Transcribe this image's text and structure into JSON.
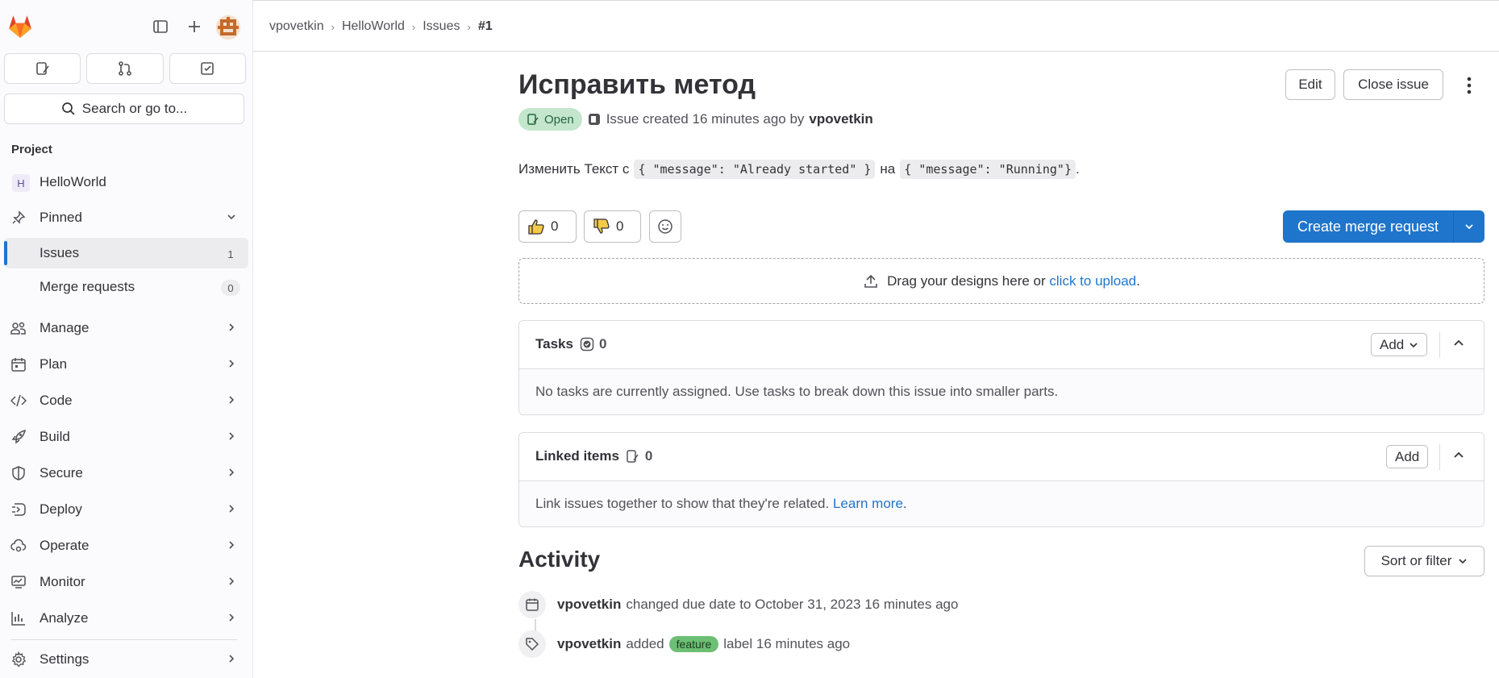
{
  "sidebar": {
    "search_label": "Search or go to...",
    "section_title": "Project",
    "project": {
      "initial": "H",
      "name": "HelloWorld"
    },
    "pinned_label": "Pinned",
    "pinned_items": [
      {
        "label": "Issues",
        "count": "1"
      },
      {
        "label": "Merge requests",
        "count": "0"
      }
    ],
    "menu": [
      {
        "label": "Manage",
        "icon": "users-icon"
      },
      {
        "label": "Plan",
        "icon": "calendar-icon"
      },
      {
        "label": "Code",
        "icon": "code-icon"
      },
      {
        "label": "Build",
        "icon": "rocket-icon"
      },
      {
        "label": "Secure",
        "icon": "shield-icon"
      },
      {
        "label": "Deploy",
        "icon": "deploy-icon"
      },
      {
        "label": "Operate",
        "icon": "cloud-gear-icon"
      },
      {
        "label": "Monitor",
        "icon": "monitor-icon"
      },
      {
        "label": "Analyze",
        "icon": "chart-icon"
      }
    ],
    "settings_label": "Settings"
  },
  "breadcrumbs": [
    "vpovetkin",
    "HelloWorld",
    "Issues",
    "#1"
  ],
  "issue": {
    "title": "Исправить метод",
    "status": "Open",
    "meta_prefix": "Issue created 16 minutes ago by",
    "author": "vpovetkin",
    "desc_text1": "Изменить Текст с",
    "code1": "{ \"message\": \"Already started\" }",
    "desc_text2": "на",
    "code2": "{ \"message\": \"Running\"}",
    "desc_end": "."
  },
  "actions": {
    "edit": "Edit",
    "close": "Close issue"
  },
  "reactions": {
    "thumbs_up": "0",
    "thumbs_down": "0"
  },
  "create_mr": "Create merge request",
  "dropzone": {
    "text": "Drag your designs here or",
    "link": "click to upload",
    "end": "."
  },
  "tasks": {
    "title": "Tasks",
    "count": "0",
    "add": "Add",
    "empty": "No tasks are currently assigned. Use tasks to break down this issue into smaller parts."
  },
  "linked": {
    "title": "Linked items",
    "count": "0",
    "add": "Add",
    "empty": "Link issues together to show that they're related.",
    "learn": "Learn more",
    "end": "."
  },
  "activity": {
    "title": "Activity",
    "sort": "Sort or filter",
    "events": [
      {
        "user": "vpovetkin",
        "text": "changed due date to October 31, 2023 16 minutes ago"
      },
      {
        "user": "vpovetkin",
        "text_before": "added",
        "label": "feature",
        "text_after": "label 16 minutes ago"
      }
    ]
  },
  "colors": {
    "accent": "#1f75cb",
    "open_badge_bg": "#c3e6cd",
    "label_feature": "#6cbf73",
    "brand_orange": "#e24329"
  }
}
